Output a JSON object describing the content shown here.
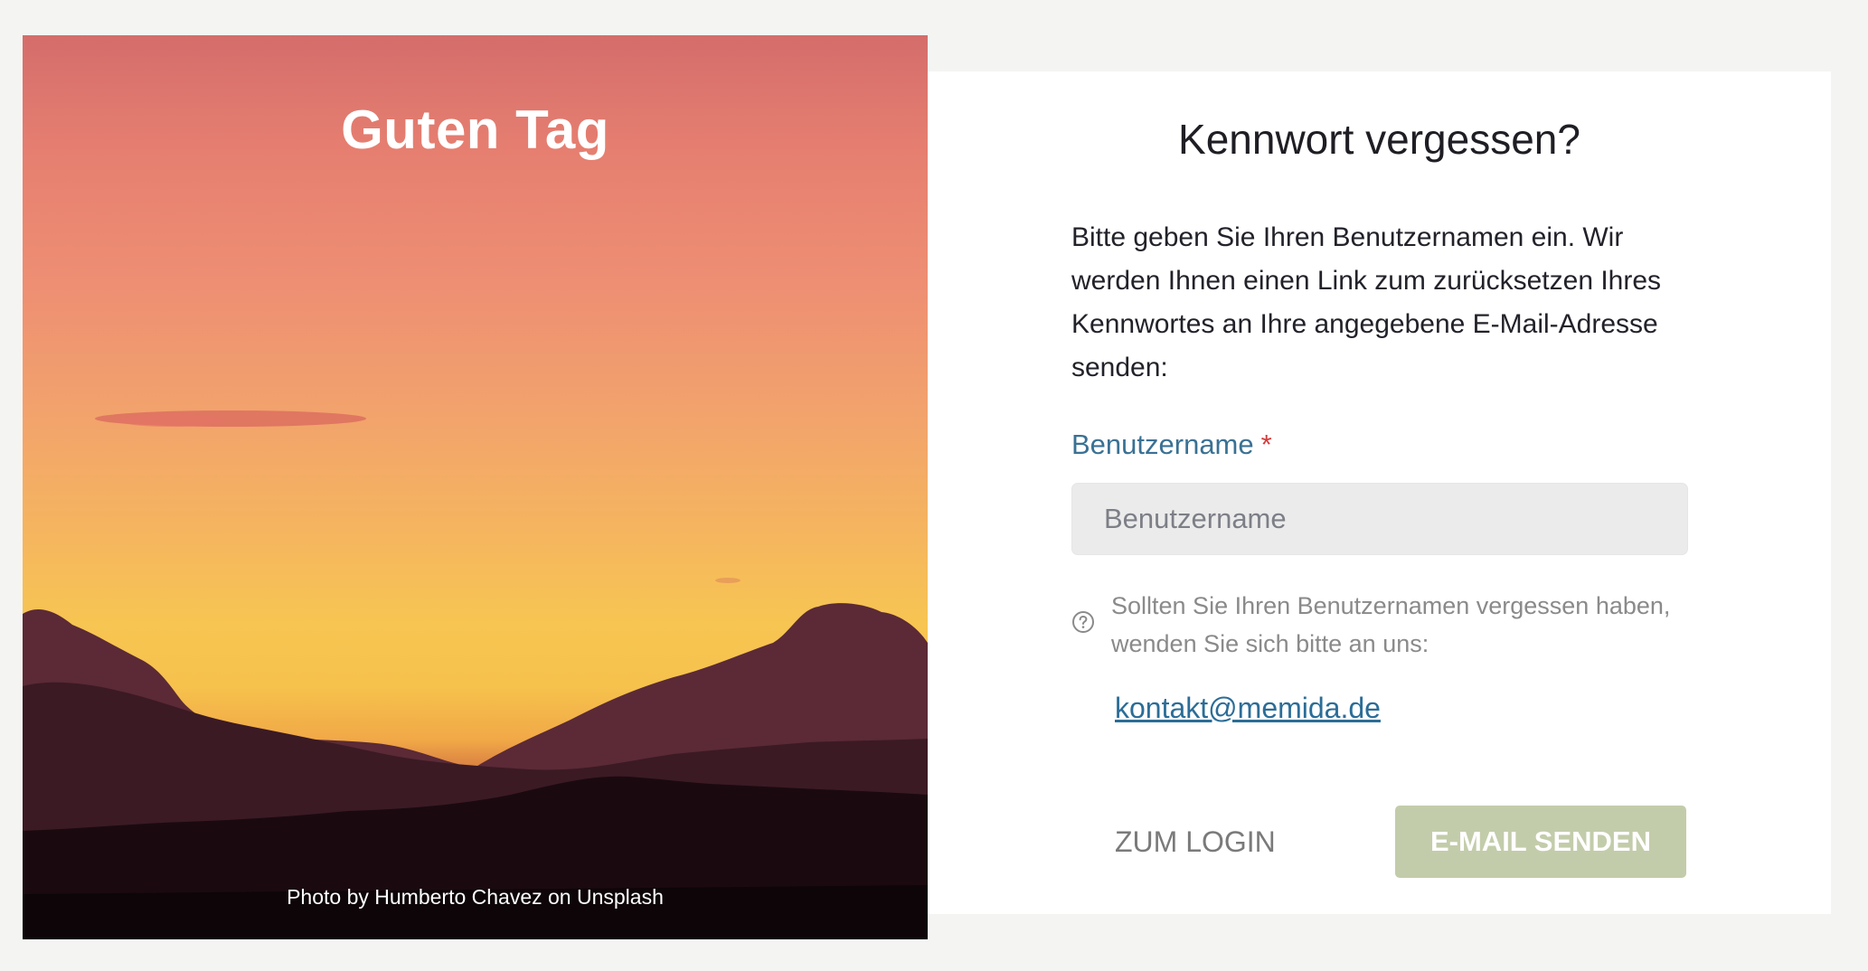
{
  "photo_panel": {
    "greeting": "Guten Tag",
    "credit": "Photo by Humberto Chavez on Unsplash"
  },
  "form": {
    "title": "Kennwort vergessen?",
    "intro": "Bitte geben Sie Ihren Benutzernamen ein. Wir werden Ihnen einen Link zum zurücksetzen Ihres Kennwortes an Ihre angegebene E-Mail-Adresse senden:",
    "username": {
      "label": "Benutzername",
      "required_marker": "*",
      "placeholder": "Benutzername",
      "value": ""
    },
    "help_text": "Sollten Sie Ihren Benutzernamen vergessen haben, wenden Sie sich bitte an uns:",
    "contact_email": "kontakt@memida.de",
    "login_button": "ZUM LOGIN",
    "send_button": "E-MAIL SENDEN"
  },
  "icons": {
    "help": "question-circle-icon"
  },
  "colors": {
    "page_background": "#f4f4f2",
    "label_blue": "#3a7194",
    "required_red": "#d23b3b",
    "link_blue": "#2c6d97",
    "send_button_green": "#c3ccaa",
    "input_background": "#ebebeb"
  }
}
